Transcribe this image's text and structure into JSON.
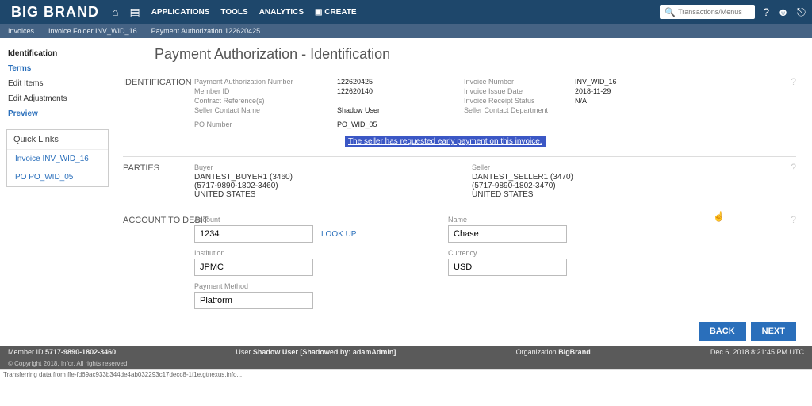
{
  "brand": "BIG BRAND",
  "topnav": {
    "applications": "APPLICATIONS",
    "tools": "TOOLS",
    "analytics": "ANALYTICS",
    "create": "CREATE"
  },
  "search": {
    "placeholder": "Transactions/Menus"
  },
  "breadcrumb": {
    "a": "Invoices",
    "b": "Invoice Folder INV_WID_16",
    "c": "Payment Authorization 122620425"
  },
  "sidemenu": {
    "identification": "Identification",
    "terms": "Terms",
    "edit_items": "Edit Items",
    "edit_adjustments": "Edit Adjustments",
    "preview": "Preview"
  },
  "quicklinks": {
    "header": "Quick Links",
    "items": [
      "Invoice INV_WID_16",
      "PO PO_WID_05"
    ]
  },
  "page_title": "Payment Authorization - Identification",
  "sections": {
    "identification": {
      "title": "IDENTIFICATION",
      "labels": {
        "pan": "Payment Authorization Number",
        "member": "Member ID",
        "contract": "Contract Reference(s)",
        "seller_contact": "Seller Contact Name",
        "po": "PO Number",
        "invoice_no": "Invoice Number",
        "issue_date": "Invoice Issue Date",
        "receipt_status": "Invoice Receipt Status",
        "seller_dept": "Seller Contact Department"
      },
      "values": {
        "pan": "122620425",
        "member": "122620140",
        "seller_contact": "Shadow User",
        "po": "PO_WID_05",
        "invoice_no": "INV_WID_16",
        "issue_date": "2018-11-29",
        "receipt_status": "N/A"
      },
      "highlight": "The seller has requested early payment on this invoice."
    },
    "parties": {
      "title": "PARTIES",
      "buyer_label": "Buyer",
      "seller_label": "Seller",
      "buyer": {
        "name": "DANTEST_BUYER1 (3460)",
        "phone": "(5717-9890-1802-3460)",
        "country": "UNITED STATES"
      },
      "seller": {
        "name": "DANTEST_SELLER1 (3470)",
        "phone": "(5717-9890-1802-3470)",
        "country": "UNITED STATES"
      }
    },
    "account": {
      "title": "ACCOUNT TO DEBIT",
      "labels": {
        "account": "Account",
        "name": "Name",
        "institution": "Institution",
        "currency": "Currency",
        "payment_method": "Payment Method"
      },
      "values": {
        "account": "1234",
        "name": "Chase",
        "institution": "JPMC",
        "currency": "USD",
        "payment_method": "Platform"
      },
      "lookup": "LOOK UP"
    }
  },
  "buttons": {
    "back": "BACK",
    "next": "NEXT"
  },
  "footer": {
    "member_lbl": "Member ID",
    "member_val": "5717-9890-1802-3460",
    "user_lbl": "User",
    "user_val": "Shadow User [Shadowed by: adamAdmin]",
    "org_lbl": "Organization",
    "org_val": "BigBrand",
    "date": "Dec 6, 2018 8:21:45 PM UTC",
    "copyright": "© Copyright 2018. Infor. All rights reserved."
  },
  "status_bar": "Transferring data from ffe-fd69ac933b344de4ab032293c17decc8-1f1e.gtnexus.info..."
}
